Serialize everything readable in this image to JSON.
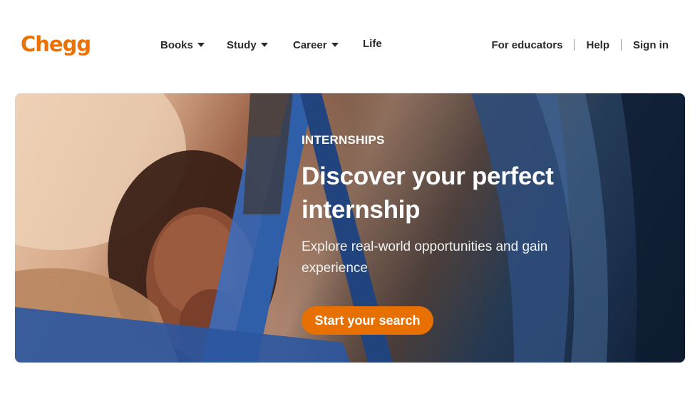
{
  "header": {
    "logo_text": "Chegg",
    "nav": [
      {
        "label": "Books",
        "has_dropdown": true
      },
      {
        "label": "Study",
        "has_dropdown": true
      },
      {
        "label": "Career",
        "has_dropdown": true
      },
      {
        "label": "Life",
        "has_dropdown": false
      }
    ],
    "utility": [
      {
        "label": "For educators"
      },
      {
        "label": "Help"
      },
      {
        "label": "Sign in"
      }
    ]
  },
  "hero": {
    "eyebrow": "INTERNSHIPS",
    "headline_line1": "Discover your perfect",
    "headline_line2": "internship",
    "subtitle_line1": "Explore real-world opportunities and gain",
    "subtitle_line2": "experience",
    "cta_label": "Start your search"
  },
  "colors": {
    "brand": "#eb7100",
    "cta": "#e87000",
    "text": "#2b2b2b"
  }
}
